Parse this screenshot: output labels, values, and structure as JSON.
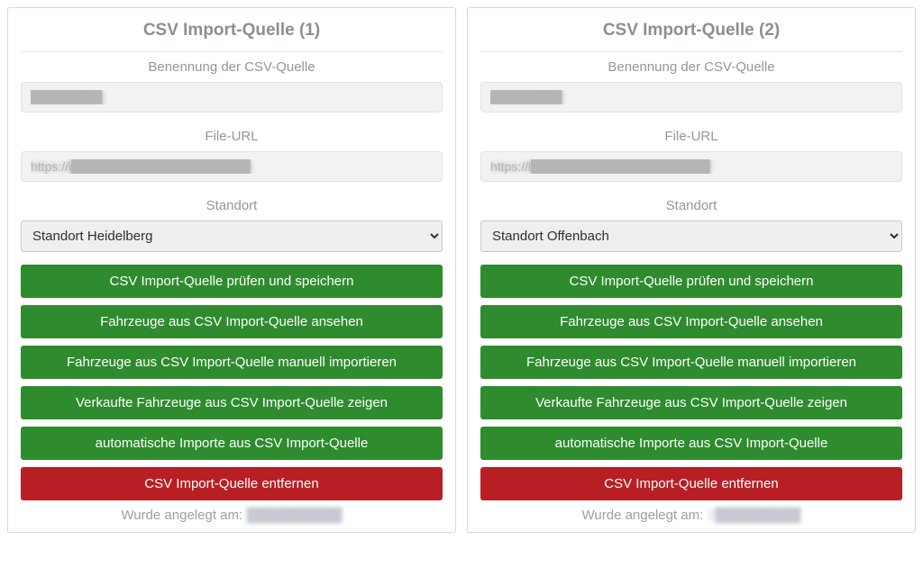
{
  "cards": [
    {
      "title": "CSV Import-Quelle (1)",
      "name_label": "Benennung der CSV-Quelle",
      "name_value": "████████",
      "url_label": "File-URL",
      "url_value": "https://i████████████████████",
      "location_label": "Standort",
      "location_value": "Standort Heidelberg",
      "btn_check": "CSV Import-Quelle prüfen und speichern",
      "btn_view": "Fahrzeuge aus CSV Import-Quelle ansehen",
      "btn_import": "Fahrzeuge aus CSV Import-Quelle manuell importieren",
      "btn_sold": "Verkaufte Fahrzeuge aus CSV Import-Quelle zeigen",
      "btn_auto": "automatische Importe aus CSV Import-Quelle",
      "btn_remove": "CSV Import-Quelle entfernen",
      "created_label": "Wurde angelegt am:",
      "created_value": "██████████"
    },
    {
      "title": "CSV Import-Quelle (2)",
      "name_label": "Benennung der CSV-Quelle",
      "name_value": "████████",
      "url_label": "File-URL",
      "url_value": "https://i████████████████████",
      "location_label": "Standort",
      "location_value": "Standort Offenbach",
      "btn_check": "CSV Import-Quelle prüfen und speichern",
      "btn_view": "Fahrzeuge aus CSV Import-Quelle ansehen",
      "btn_import": "Fahrzeuge aus CSV Import-Quelle manuell importieren",
      "btn_sold": "Verkaufte Fahrzeuge aus CSV Import-Quelle zeigen",
      "btn_auto": "automatische Importe aus CSV Import-Quelle",
      "btn_remove": "CSV Import-Quelle entfernen",
      "created_label": "Wurde angelegt am:",
      "created_value": "2█████████"
    }
  ]
}
